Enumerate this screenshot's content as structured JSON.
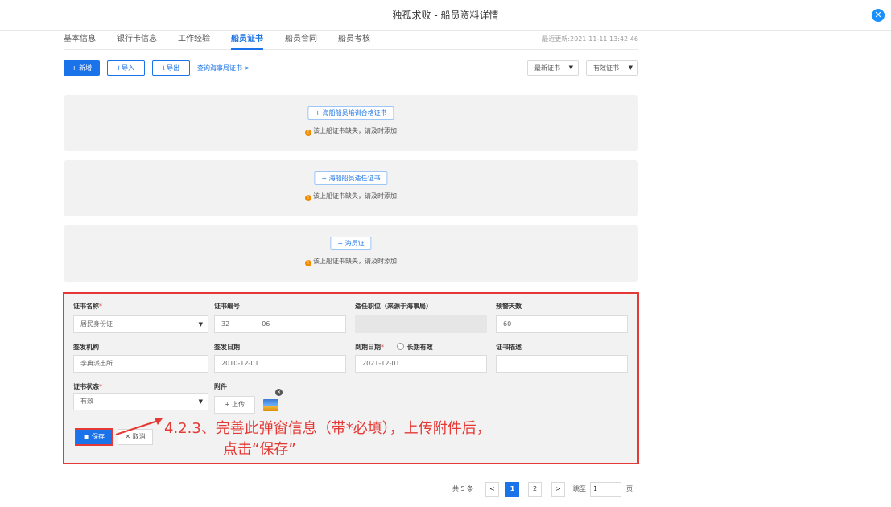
{
  "header": {
    "title": "独孤求败 - 船员资料详情",
    "close_icon": "close-icon"
  },
  "tabs": [
    {
      "label": "基本信息",
      "active": false
    },
    {
      "label": "银行卡信息",
      "active": false
    },
    {
      "label": "工作经验",
      "active": false
    },
    {
      "label": "船员证书",
      "active": true
    },
    {
      "label": "船员合同",
      "active": false
    },
    {
      "label": "船员考核",
      "active": false
    }
  ],
  "last_updated": "最近更新:2021-11-11 13:42:46",
  "toolbar": {
    "add_label": "+ 新增",
    "import_label": "导入",
    "export_label": "导出",
    "query_link": "查询海事局证书 >",
    "sort_select": "最新证书",
    "filter_select": "有效证书"
  },
  "cert_boxes": [
    {
      "add_label": "+ 海船船员培训合格证书",
      "warning": "该上船证书缺失，请及时添加"
    },
    {
      "add_label": "+ 海船船员适任证书",
      "warning": "该上船证书缺失，请及时添加"
    },
    {
      "add_label": "+ 海员证",
      "warning": "该上船证书缺失，请及时添加"
    }
  ],
  "form": {
    "cert_name": {
      "label": "证书名称",
      "required": "*",
      "value": "居民身份证"
    },
    "cert_number": {
      "label": "证书编号",
      "value_start": "32",
      "value_end": "06"
    },
    "position": {
      "label": "适任职位（来源于海事局）",
      "value": ""
    },
    "warning_days": {
      "label": "预警天数",
      "value": "60"
    },
    "issuer": {
      "label": "签发机构",
      "value": "李典派出所"
    },
    "issue_date": {
      "label": "签发日期",
      "value": "2010-12-01"
    },
    "expiry_date": {
      "label": "到期日期",
      "required": "*",
      "long_term_label": "长期有效",
      "value": "2021-12-01"
    },
    "description": {
      "label": "证书描述",
      "value": ""
    },
    "status": {
      "label": "证书状态",
      "required": "*",
      "value": "有效"
    },
    "attachment": {
      "label": "附件",
      "upload_label": "+ 上传"
    },
    "save_label": "保存",
    "cancel_label": "取消"
  },
  "annotation": {
    "line1": "4.2.3、完善此弹窗信息（带*必填），上传附件后，",
    "line2": "点击“保存”"
  },
  "pagination": {
    "total": "共 5 条",
    "prev": "<",
    "pages": [
      "1",
      "2"
    ],
    "current": "1",
    "next": ">",
    "goto_label": "跳至",
    "goto_value": "1",
    "page_unit": "页"
  },
  "colors": {
    "accent": "#1a73e8",
    "highlight": "#e53935",
    "warning": "#f08c00"
  }
}
